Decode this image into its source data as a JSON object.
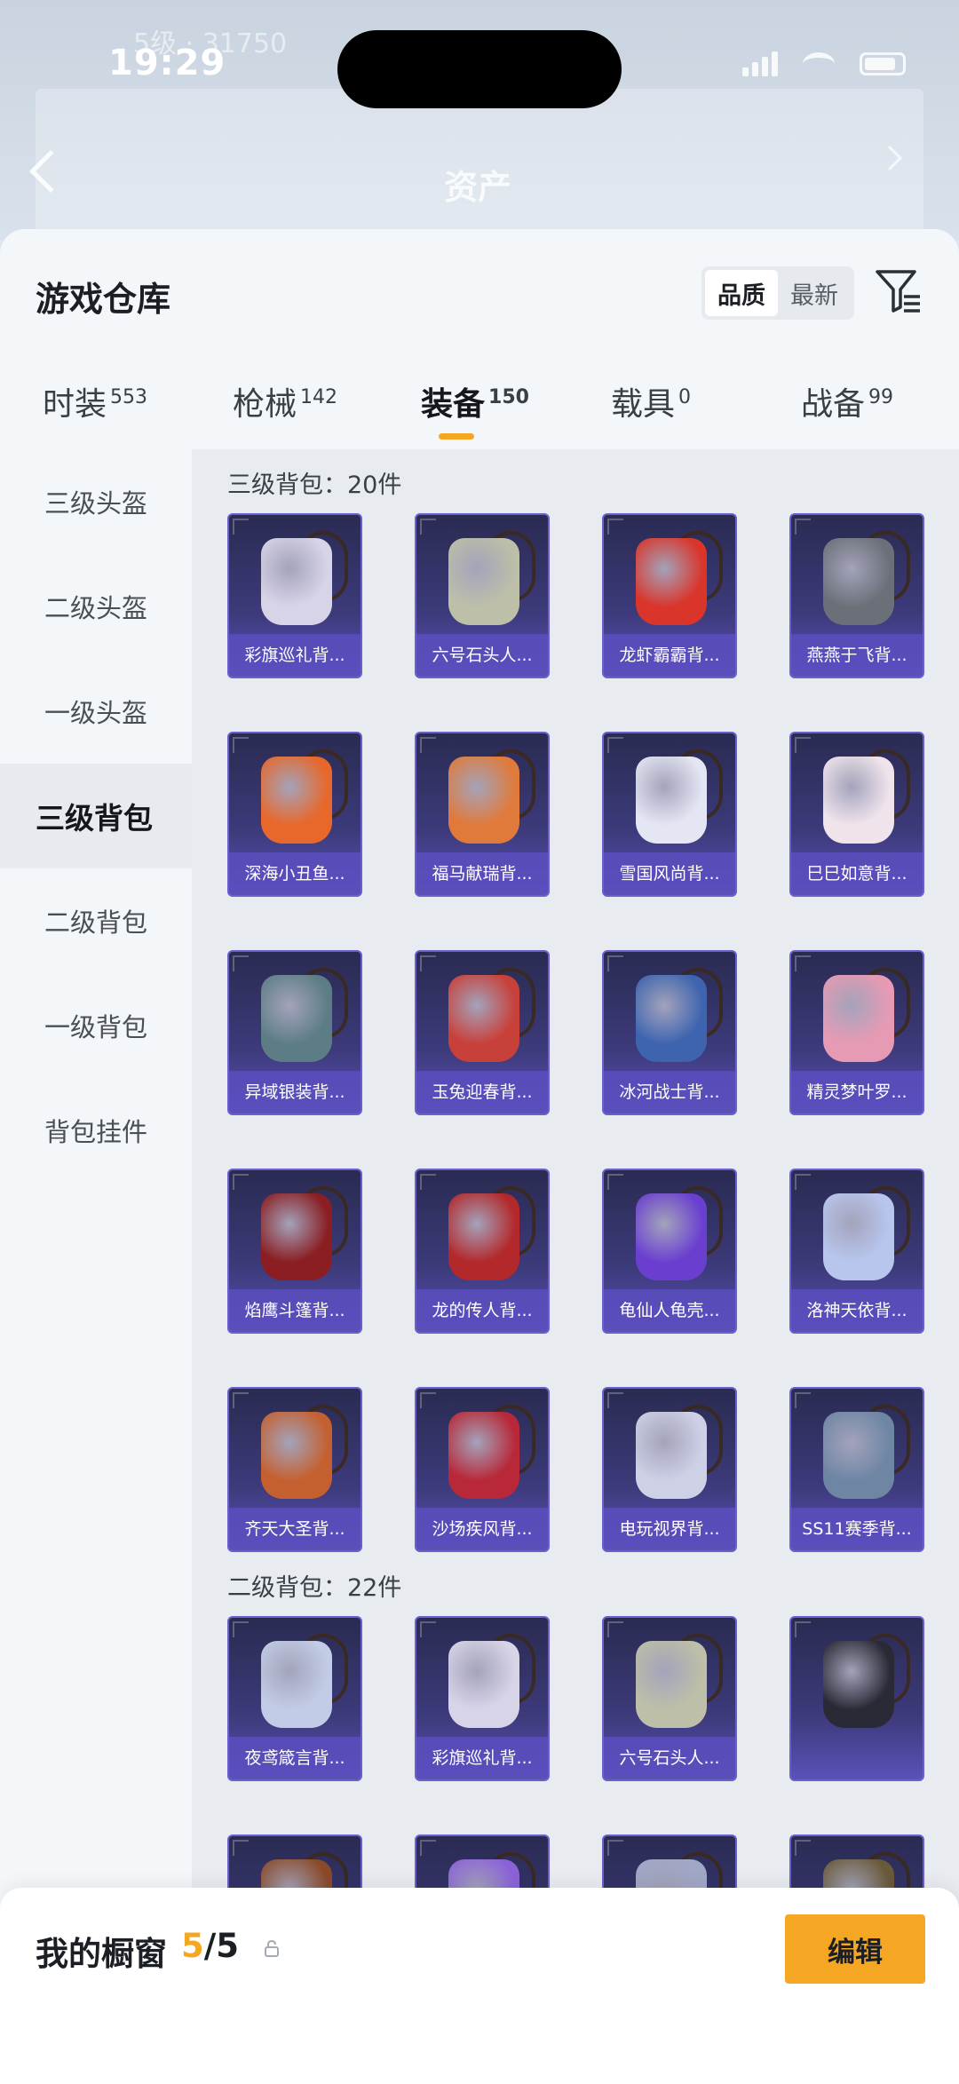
{
  "status_bar": {
    "time": "19:29"
  },
  "backdrop": {
    "title": "资产",
    "faded_line": "5级 · 31750"
  },
  "warehouse": {
    "title": "游戏仓库"
  },
  "sort": {
    "options": [
      "品质",
      "最新"
    ],
    "selected": "品质"
  },
  "tabs": [
    {
      "label": "时装",
      "count": "553"
    },
    {
      "label": "枪械",
      "count": "142"
    },
    {
      "label": "装备",
      "count": "150",
      "active": true
    },
    {
      "label": "载具",
      "count": "0"
    },
    {
      "label": "战备",
      "count": "99"
    }
  ],
  "sidebar": {
    "items": [
      {
        "label": "三级头盔"
      },
      {
        "label": "二级头盔"
      },
      {
        "label": "一级头盔"
      },
      {
        "label": "三级背包",
        "active": true
      },
      {
        "label": "二级背包"
      },
      {
        "label": "一级背包"
      },
      {
        "label": "背包挂件"
      }
    ]
  },
  "sections": [
    {
      "header": "三级背包：20件",
      "items": [
        {
          "name": "彩旗巡礼背...",
          "color": "#d8d4e8"
        },
        {
          "name": "六号石头人...",
          "color": "#bdbfa8"
        },
        {
          "name": "龙虾霸霸背...",
          "color": "#d9352b"
        },
        {
          "name": "燕燕于飞背...",
          "color": "#6b7078"
        },
        {
          "name": "深海小丑鱼...",
          "color": "#e8672a"
        },
        {
          "name": "福马献瑞背...",
          "color": "#e07a3a"
        },
        {
          "name": "雪国风尚背...",
          "color": "#e4e6f4"
        },
        {
          "name": "巳巳如意背...",
          "color": "#f0e4ec"
        },
        {
          "name": "异域银装背...",
          "color": "#5d7d86"
        },
        {
          "name": "玉兔迎春背...",
          "color": "#c8403a"
        },
        {
          "name": "冰河战士背...",
          "color": "#3e64b0"
        },
        {
          "name": "精灵梦叶罗...",
          "color": "#e79ab4"
        },
        {
          "name": "焰鹰斗篷背...",
          "color": "#8a1e22"
        },
        {
          "name": "龙的传人背...",
          "color": "#b3282a"
        },
        {
          "name": "龟仙人龟壳...",
          "color": "#6a3fd0"
        },
        {
          "name": "洛神天依背...",
          "color": "#b8c6ee"
        },
        {
          "name": "齐天大圣背...",
          "color": "#c46030"
        },
        {
          "name": "沙场疾风背...",
          "color": "#b82838"
        },
        {
          "name": "电玩视界背...",
          "color": "#ced0e6"
        },
        {
          "name": "SS11赛季背...",
          "color": "#6e86a4"
        }
      ]
    },
    {
      "header": "二级背包：22件",
      "items": [
        {
          "name": "夜鸢箴言背...",
          "color": "#c2cce6"
        },
        {
          "name": "彩旗巡礼背...",
          "color": "#d8d4e8"
        },
        {
          "name": "六号石头人...",
          "color": "#bdbfa8"
        },
        {
          "name": "",
          "color": "#2a2a36"
        },
        {
          "name": "",
          "color": "#8a4a2a"
        },
        {
          "name": "",
          "color": "#8a62d8"
        },
        {
          "name": "",
          "color": "#a0a8c8"
        },
        {
          "name": "",
          "color": "#6a5a3a"
        }
      ]
    }
  ],
  "showcase": {
    "title": "我的橱窗",
    "count_current": "5",
    "count_total": "/5",
    "edit_label": "编辑"
  },
  "icons": {
    "fab": "share-edit-icon",
    "filter": "filter-icon",
    "lock": "lock-icon",
    "back": "back-chevron-icon"
  }
}
